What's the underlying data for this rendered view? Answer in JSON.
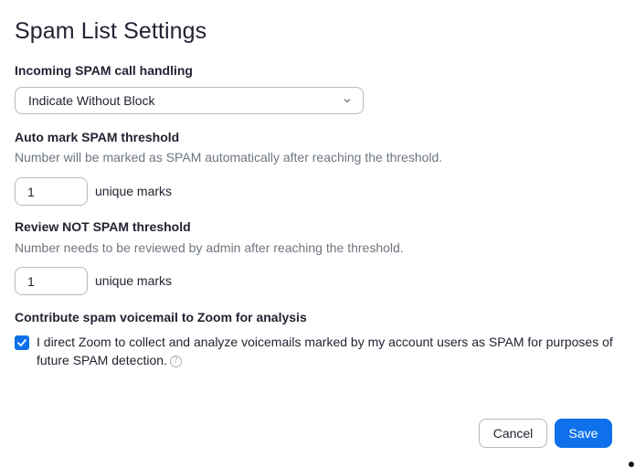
{
  "dialog": {
    "title": "Spam List Settings"
  },
  "incoming": {
    "label": "Incoming SPAM call handling",
    "selected": "Indicate Without Block"
  },
  "auto_mark": {
    "label": "Auto mark SPAM threshold",
    "description": "Number will be marked as SPAM automatically after reaching the threshold.",
    "value": "1",
    "unit": "unique marks"
  },
  "review": {
    "label": "Review NOT SPAM threshold",
    "description": "Number needs to be reviewed by admin after reaching the threshold.",
    "value": "1",
    "unit": "unique marks"
  },
  "contribute": {
    "label": "Contribute spam voicemail to Zoom for analysis",
    "checkbox_text": "I direct Zoom to collect and analyze voicemails marked by my account users as SPAM for purposes of future SPAM detection.",
    "checked": true,
    "help_icon": "question-circle-icon"
  },
  "footer": {
    "cancel_label": "Cancel",
    "save_label": "Save"
  },
  "colors": {
    "accent": "#0e71eb",
    "text": "#232333",
    "muted": "#6e7680"
  }
}
